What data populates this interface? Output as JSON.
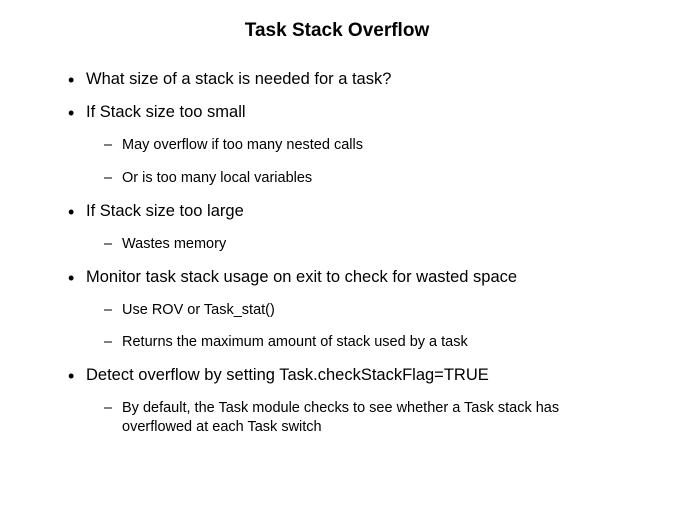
{
  "title": "Task Stack Overflow",
  "bullets": [
    {
      "text": "What size of a stack is needed for a task?",
      "sub": []
    },
    {
      "text": "If Stack size too small",
      "sub": [
        "May overflow if too many nested calls",
        "Or is too many local variables"
      ]
    },
    {
      "text": "If Stack size too large",
      "sub": [
        "Wastes memory"
      ]
    },
    {
      "text": "Monitor task stack usage on exit to check for wasted space",
      "sub": [
        "Use ROV or Task_stat()",
        "Returns the maximum amount of stack used by a task"
      ]
    },
    {
      "text": "Detect overflow by setting Task.checkStackFlag=TRUE",
      "sub": [
        "By default, the Task module checks to see whether a Task stack has overflowed at each Task switch"
      ]
    }
  ]
}
